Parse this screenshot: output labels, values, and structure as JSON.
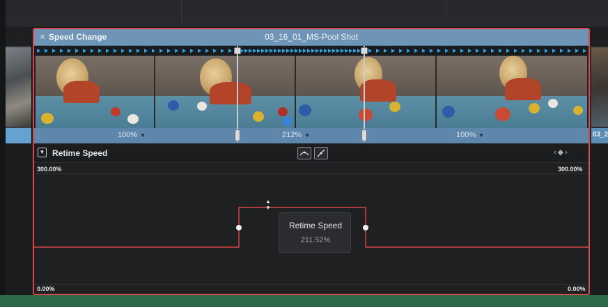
{
  "clip": {
    "header_title": "Speed Change",
    "close_glyph": "×",
    "name": "03_16_01_MS-Pool Shot",
    "next_clip_label": "03_2",
    "header_color": "#6f95b6",
    "border_color": "#d9484b"
  },
  "segments": [
    {
      "speed_label": "100%",
      "caret": "▼"
    },
    {
      "speed_label": "212%",
      "caret": "▼"
    },
    {
      "speed_label": "100%",
      "caret": "▼"
    }
  ],
  "retime": {
    "dropdown_glyph": "▼",
    "title": "Retime Speed",
    "nav_glyphs": "‹◆›",
    "curve_button_icons": [
      "ease-curve-icon",
      "linear-curve-icon"
    ]
  },
  "graph": {
    "max_label_left": "300.00%",
    "max_label_right": "300.00%",
    "min_label_left": "0.00%",
    "min_label_right": "0.00%",
    "curve_color": "#d9484b",
    "up_glyph": "▲",
    "down_glyph": "▼"
  },
  "tooltip": {
    "title": "Retime Speed",
    "value": "211.52%"
  },
  "colors": {
    "accent_blue": "#3a82d6",
    "timeline_green": "#2f6a48",
    "speed_bar": "#5e87ab"
  }
}
